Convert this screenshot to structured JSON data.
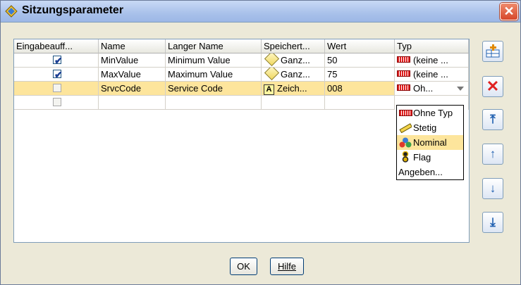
{
  "window": {
    "title": "Sitzungsparameter",
    "close_glyph": "✕"
  },
  "table": {
    "headers": [
      "Eingabeauff...",
      "Name",
      "Langer Name",
      "Speichert...",
      "Wert",
      "Typ"
    ],
    "rows": [
      {
        "checked": true,
        "name": "MinValue",
        "long_name": "Minimum Value",
        "storage": "Ganz...",
        "storage_icon": "integer-diamond-icon",
        "value": "50",
        "type": "(keine ...",
        "type_icon": "ruler-typeless-icon"
      },
      {
        "checked": true,
        "name": "MaxValue",
        "long_name": "Maximum Value",
        "storage": "Ganz...",
        "storage_icon": "integer-diamond-icon",
        "value": "75",
        "type": "(keine ...",
        "type_icon": "ruler-typeless-icon"
      },
      {
        "checked": false,
        "name": "SrvcCode",
        "long_name": "Service Code",
        "storage": "Zeich...",
        "storage_icon": "string-A-icon",
        "value": "008",
        "type": "Oh...",
        "type_icon": "ruler-typeless-icon",
        "selected": true
      },
      {
        "checked": false,
        "name": "",
        "long_name": "",
        "storage": "",
        "value": "",
        "type": ""
      }
    ]
  },
  "type_dropdown": {
    "options": [
      {
        "label": "Ohne Typ",
        "icon": "ruler-typeless-icon"
      },
      {
        "label": "Stetig",
        "icon": "ruler-continuous-icon"
      },
      {
        "label": "Nominal",
        "icon": "nominal-balls-icon",
        "highlighted": true
      },
      {
        "label": "Flag",
        "icon": "flag-icon"
      },
      {
        "label": "Angeben...",
        "icon": ""
      }
    ]
  },
  "side_buttons": [
    "add-parameter",
    "delete-parameter",
    "move-top",
    "move-up",
    "move-down",
    "move-bottom"
  ],
  "buttons": {
    "ok": "OK",
    "help": "Hilfe"
  },
  "colors": {
    "selection": "#fde59c",
    "title_gradient": "#a9c1ea",
    "close": "#d6472a"
  }
}
